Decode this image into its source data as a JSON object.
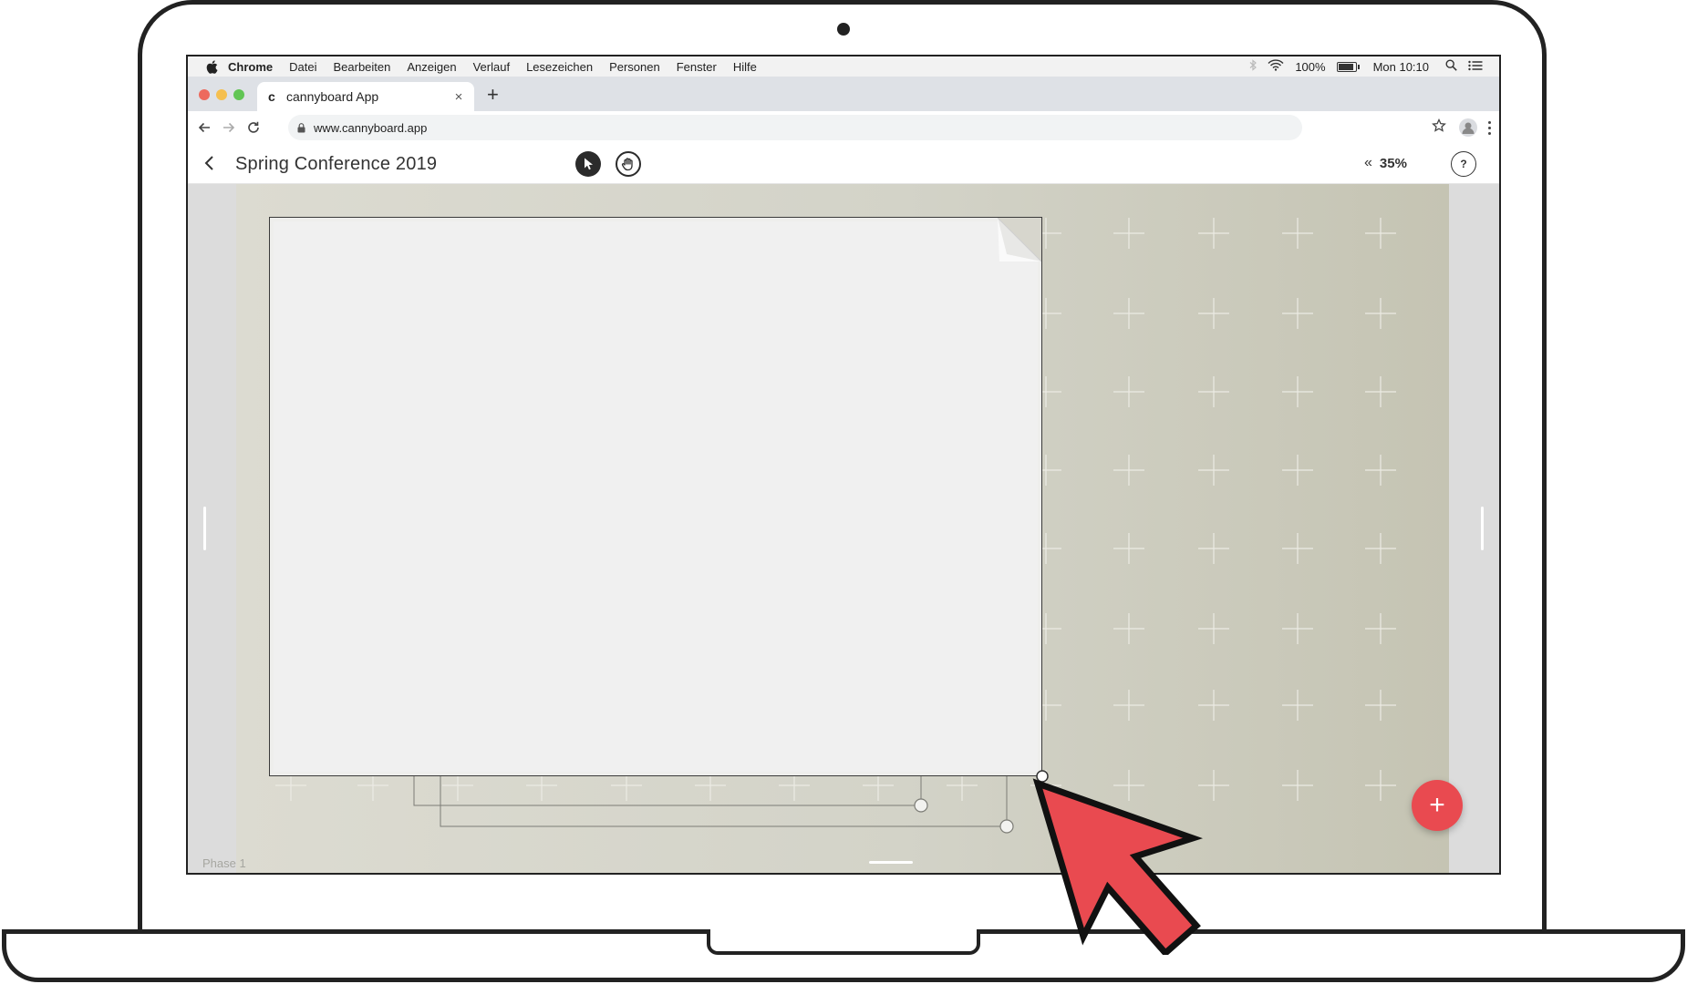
{
  "menubar": {
    "app_name": "Chrome",
    "items": [
      "Datei",
      "Bearbeiten",
      "Anzeigen",
      "Verlauf",
      "Lesezeichen",
      "Personen",
      "Fenster",
      "Hilfe"
    ],
    "battery": "100%",
    "battery_level": 1.0,
    "clock": "Mon 10:10"
  },
  "browser": {
    "tab_title": "cannyboard App",
    "tab_favicon": "c",
    "url": "www.cannyboard.app"
  },
  "app": {
    "board_title": "Spring Conference 2019",
    "zoom_label": "35%",
    "zoom_icon": "«",
    "help_label": "?",
    "phase_label": "Phase 1",
    "fab_label": "+"
  },
  "colors": {
    "accent": "#e94a50",
    "board_left": "#dcdbd1",
    "board_right": "#c5c4b3",
    "cursor_fill": "#e94a50"
  }
}
